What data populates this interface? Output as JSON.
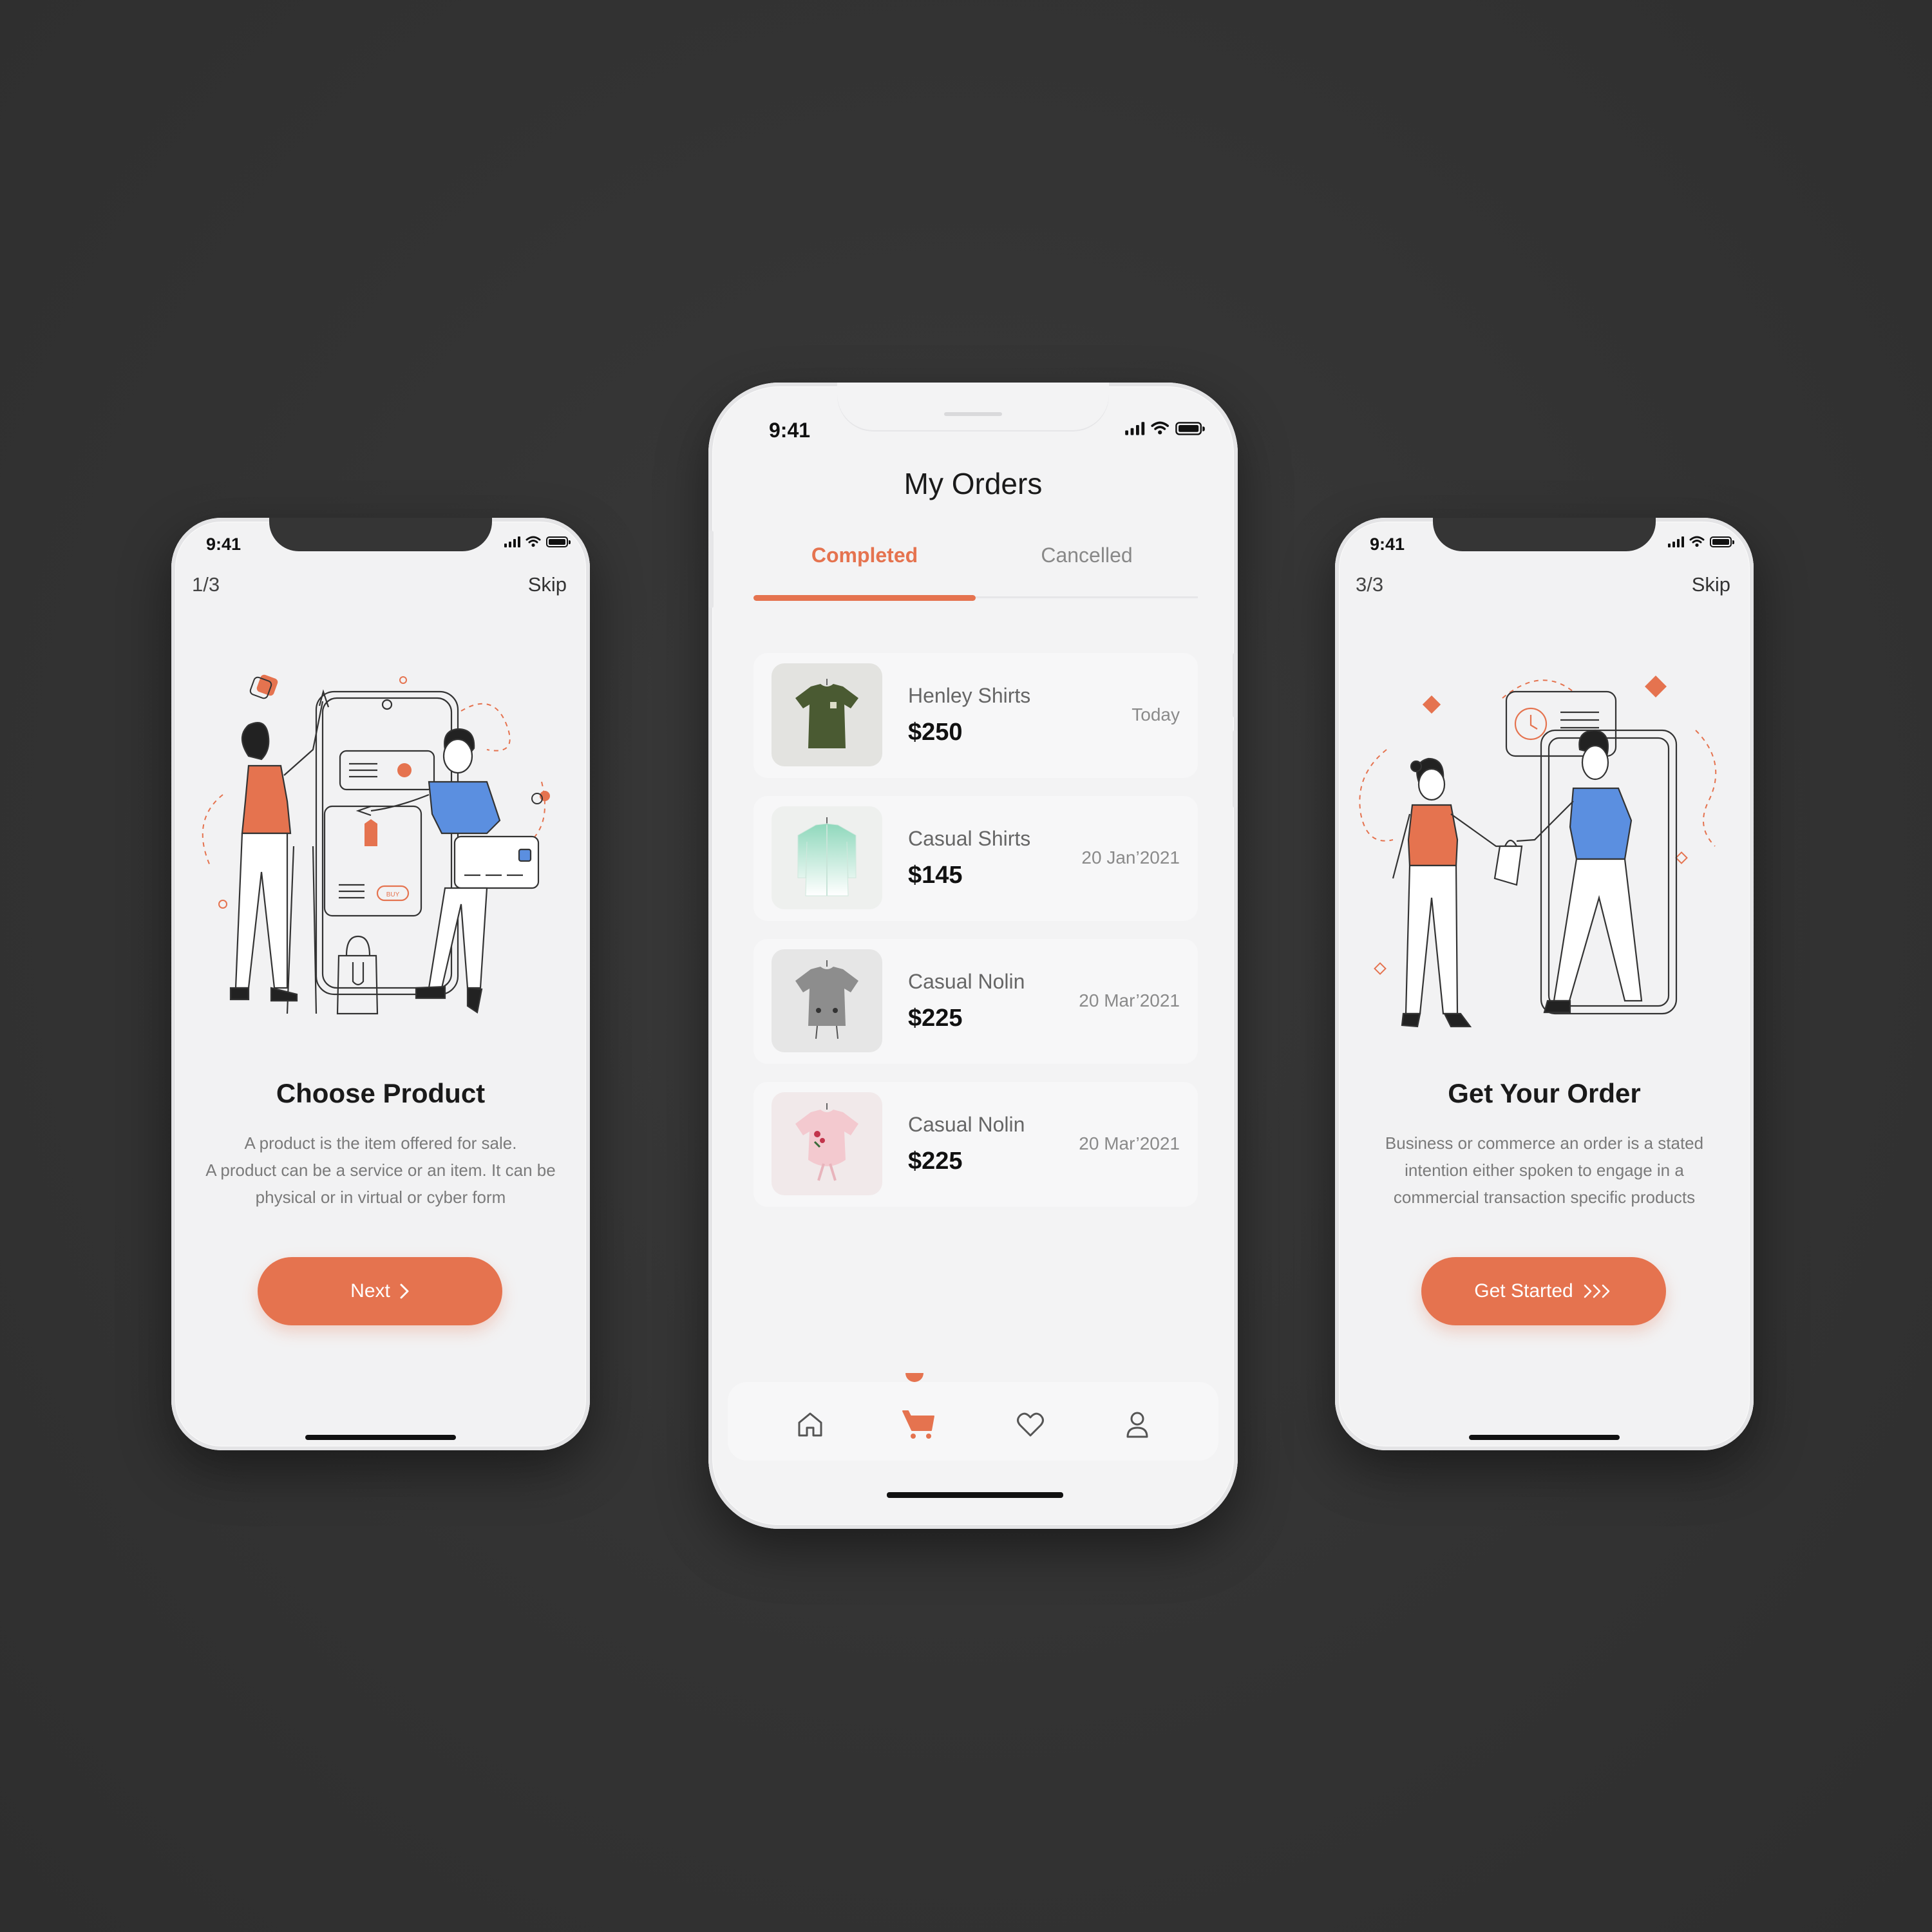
{
  "colors": {
    "accent": "#e5734f",
    "background": "#333333",
    "screen": "#f2f2f3",
    "accent_blue": "#5b8fe0"
  },
  "status_bar": {
    "time": "9:41"
  },
  "onboarding_1": {
    "page_indicator": "1/3",
    "skip_label": "Skip",
    "title": "Choose Product",
    "description_lines": [
      "A product is the item offered for sale.",
      "A product can be a service or an item. It can be",
      "physical or in virtual or cyber form"
    ],
    "button_label": "Next",
    "button_icon": "chevron-right-icon",
    "illustration_badge": "BUY"
  },
  "orders": {
    "title": "My Orders",
    "tabs": [
      {
        "label": "Completed",
        "active": true
      },
      {
        "label": "Cancelled",
        "active": false
      }
    ],
    "items": [
      {
        "name": "Henley Shirts",
        "price": "$250",
        "date": "Today",
        "thumb_color": "#e3e3e0",
        "shirt_color": "#4a5a32"
      },
      {
        "name": "Casual Shirts",
        "price": "$145",
        "date": "20 Jan’2021",
        "thumb_color": "#eef0ee",
        "shirt_color": "#9fdcc4"
      },
      {
        "name": "Casual Nolin",
        "price": "$225",
        "date": "20 Mar’2021",
        "thumb_color": "#e6e6e6",
        "shirt_color": "#8d8d8d"
      },
      {
        "name": "Casual Nolin",
        "price": "$225",
        "date": "20 Mar’2021",
        "thumb_color": "#f1e9ea",
        "shirt_color": "#f3c9cf"
      }
    ],
    "nav": [
      {
        "icon": "home-icon",
        "active": false
      },
      {
        "icon": "cart-icon",
        "active": true
      },
      {
        "icon": "heart-icon",
        "active": false
      },
      {
        "icon": "profile-icon",
        "active": false
      }
    ]
  },
  "onboarding_3": {
    "page_indicator": "3/3",
    "skip_label": "Skip",
    "title": "Get Your Order",
    "description_lines": [
      "Business or commerce an order is a stated",
      "intention either spoken to engage in a",
      "commercial transaction specific products"
    ],
    "button_label": "Get Started",
    "button_icon": "triple-chevron-right-icon"
  }
}
